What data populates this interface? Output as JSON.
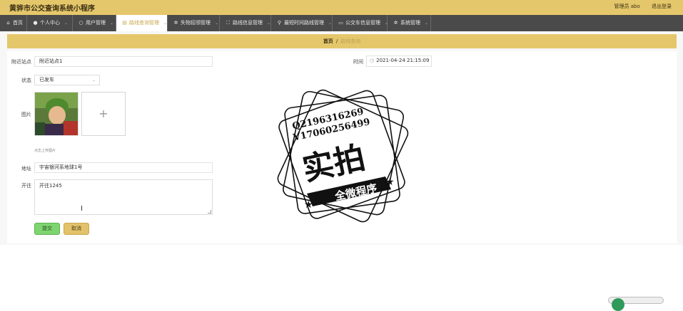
{
  "header": {
    "app_title": "黄骅市公交查询系统小程序",
    "user_label": "管理员 abo",
    "logout_label": "退出登录"
  },
  "nav": {
    "items": [
      {
        "label": "首页",
        "icon": "home-icon"
      },
      {
        "label": "个人中心",
        "icon": "user-icon"
      },
      {
        "label": "用户管理",
        "icon": "circle-icon"
      },
      {
        "label": "路线查询管理",
        "icon": "list-icon"
      },
      {
        "label": "失物招领管理",
        "icon": "gear-icon"
      },
      {
        "label": "路线信息管理",
        "icon": "expand-icon"
      },
      {
        "label": "最短时间路线管理",
        "icon": "pin-icon"
      },
      {
        "label": "公交车信息管理",
        "icon": "bus-icon"
      },
      {
        "label": "系统管理",
        "icon": "gear-icon"
      }
    ]
  },
  "breadcrumb": {
    "home": "首页",
    "separator": "/",
    "current": "路线查询"
  },
  "form": {
    "nearby_station_label": "附近站点",
    "nearby_station_value": "附近站点1",
    "time_label": "时间",
    "time_value": "2021-04-24 21:15:09",
    "status_label": "状态",
    "status_value": "已发车",
    "image_label": "图片",
    "upload_hint": "点击上传图片",
    "address_label": "地址",
    "address_value": "宇宙银河系地球1号",
    "depart_label": "开往",
    "depart_value": "开往1245"
  },
  "buttons": {
    "submit": "提交",
    "cancel": "取消"
  },
  "watermark": {
    "line1": "Q2196316269",
    "line2": "V17060256499",
    "main": "实拍",
    "banner": "全微程序"
  }
}
